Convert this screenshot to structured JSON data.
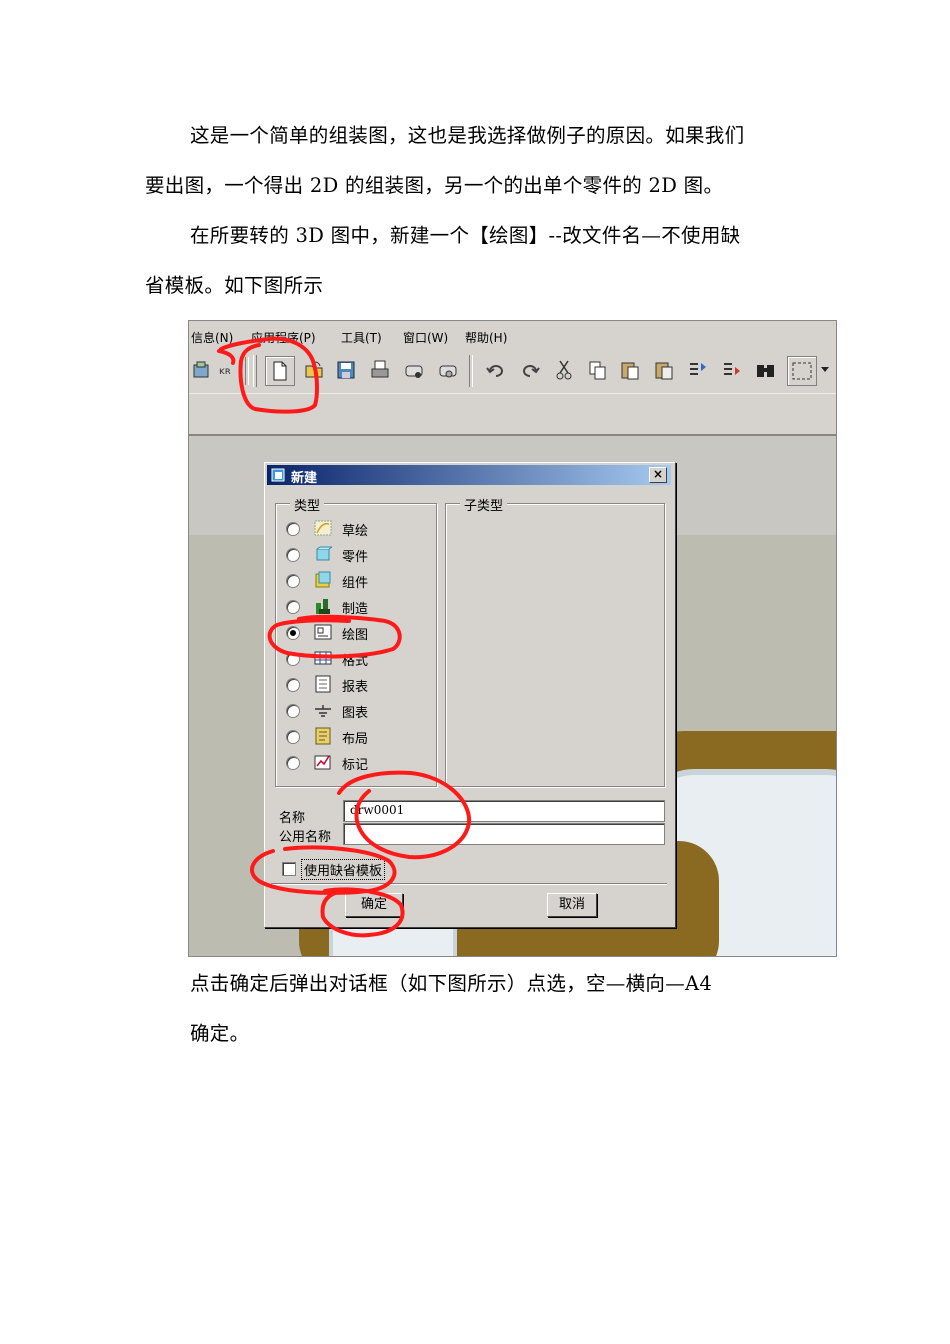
{
  "doc": {
    "para1_line1": "这是一个简单的组装图，这也是我选择做例子的原因。如果我们",
    "para1_line2": "要出图，一个得出 2D 的组装图，另一个的出单个零件的 2D 图。",
    "para2_line1": "在所要转的 3D 图中，新建一个【绘图】--改文件名—不使用缺",
    "para2_line2": "省模板。如下图所示",
    "para3_line1": "点击确定后弹出对话框（如下图所示）点选，空—横向—A4",
    "para3_line2": "确定。"
  },
  "menubar": {
    "items": [
      "信息(N)",
      "应用程序(P)",
      "工具(T)",
      "窗口(W)",
      "帮助(H)"
    ]
  },
  "dialog": {
    "title": "新建",
    "close_label": "×",
    "type_group_label": "类型",
    "subtype_group_label": "子类型",
    "types": [
      {
        "label": "草绘",
        "icon": "sketch-icon",
        "checked": false
      },
      {
        "label": "零件",
        "icon": "part-icon",
        "checked": false
      },
      {
        "label": "组件",
        "icon": "assembly-icon",
        "checked": false
      },
      {
        "label": "制造",
        "icon": "manufacturing-icon",
        "checked": false
      },
      {
        "label": "绘图",
        "icon": "drawing-icon",
        "checked": true
      },
      {
        "label": "格式",
        "icon": "format-icon",
        "checked": false
      },
      {
        "label": "报表",
        "icon": "report-icon",
        "checked": false
      },
      {
        "label": "图表",
        "icon": "diagram-icon",
        "checked": false
      },
      {
        "label": "布局",
        "icon": "layout-icon",
        "checked": false
      },
      {
        "label": "标记",
        "icon": "markup-icon",
        "checked": false
      }
    ],
    "name_label": "名称",
    "name_value": "drw0001",
    "common_name_label": "公用名称",
    "common_name_value": "",
    "use_default_template_label": "使用缺省模板",
    "use_default_template_checked": false,
    "ok_label": "确定",
    "cancel_label": "取消"
  },
  "colors": {
    "annotation": "#ff1a1a",
    "titlebar_start": "#0a246a",
    "titlebar_end": "#a6caf0",
    "window_face": "#d6d3ce"
  }
}
